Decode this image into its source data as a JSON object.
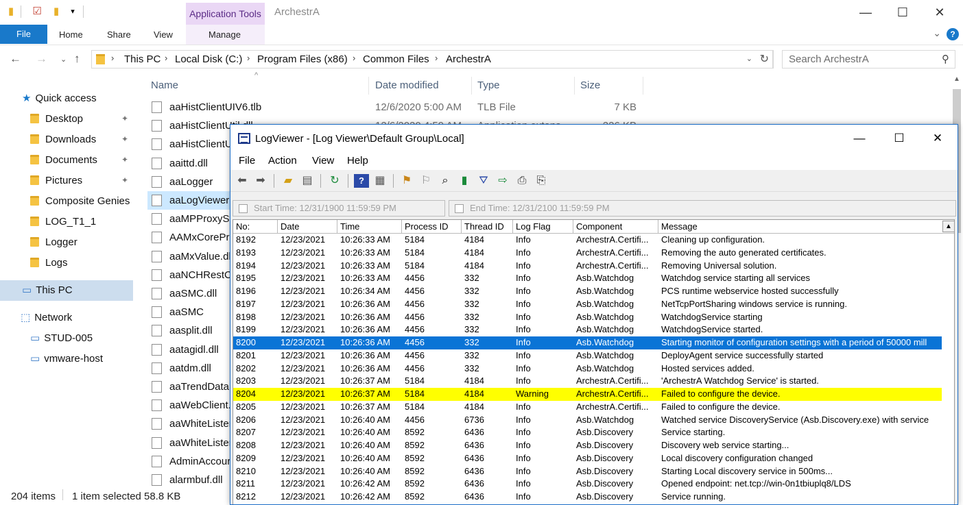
{
  "explorer": {
    "title": "ArchestrA",
    "app_tools_tab": "Application Tools",
    "ribbon": {
      "file": "File",
      "home": "Home",
      "share": "Share",
      "view": "View",
      "manage": "Manage",
      "help": "?"
    },
    "breadcrumb": [
      "This PC",
      "Local Disk (C:)",
      "Program Files (x86)",
      "Common Files",
      "ArchestrA"
    ],
    "search_placeholder": "Search ArchestrA",
    "columns": {
      "name": "Name",
      "date": "Date modified",
      "type": "Type",
      "size": "Size"
    },
    "sidebar": {
      "quick_access": "Quick access",
      "items": [
        {
          "label": "Desktop",
          "pinned": true
        },
        {
          "label": "Downloads",
          "pinned": true
        },
        {
          "label": "Documents",
          "pinned": true
        },
        {
          "label": "Pictures",
          "pinned": true
        },
        {
          "label": "Composite Genies",
          "pinned": false
        },
        {
          "label": "LOG_T1_1",
          "pinned": false
        },
        {
          "label": "Logger",
          "pinned": false
        },
        {
          "label": "Logs",
          "pinned": false
        }
      ],
      "this_pc": "This PC",
      "network": "Network",
      "network_items": [
        "STUD-005",
        "vmware-host"
      ]
    },
    "files": [
      {
        "name": "aaHistClientUIV6.tlb",
        "date": "12/6/2020 5:00 AM",
        "type": "TLB File",
        "size": "7 KB"
      },
      {
        "name": "aaHistClientUtil.dll",
        "date": "12/6/2020 4:59 AM",
        "type": "Application extens",
        "size": "226 KB"
      },
      {
        "name": "aaHistClientU",
        "date": "",
        "type": "",
        "size": ""
      },
      {
        "name": "aaittd.dll",
        "date": "",
        "type": "",
        "size": ""
      },
      {
        "name": "aaLogger",
        "date": "",
        "type": "",
        "size": ""
      },
      {
        "name": "aaLogViewer",
        "date": "",
        "type": "",
        "size": ""
      },
      {
        "name": "aaMPProxySt",
        "date": "",
        "type": "",
        "size": ""
      },
      {
        "name": "AAMxCorePro",
        "date": "",
        "type": "",
        "size": ""
      },
      {
        "name": "aaMxValue.dll",
        "date": "",
        "type": "",
        "size": ""
      },
      {
        "name": "aaNCHRestCl",
        "date": "",
        "type": "",
        "size": ""
      },
      {
        "name": "aaSMC.dll",
        "date": "",
        "type": "",
        "size": ""
      },
      {
        "name": "aaSMC",
        "date": "",
        "type": "",
        "size": ""
      },
      {
        "name": "aasplit.dll",
        "date": "",
        "type": "",
        "size": ""
      },
      {
        "name": "aatagidl.dll",
        "date": "",
        "type": "",
        "size": ""
      },
      {
        "name": "aatdm.dll",
        "date": "",
        "type": "",
        "size": ""
      },
      {
        "name": "aaTrendDataS",
        "date": "",
        "type": "",
        "size": ""
      },
      {
        "name": "aaWebClient.",
        "date": "",
        "type": "",
        "size": ""
      },
      {
        "name": "aaWhiteLister",
        "date": "",
        "type": "",
        "size": ""
      },
      {
        "name": "aaWhiteLister",
        "date": "",
        "type": "",
        "size": ""
      },
      {
        "name": "AdminAccour",
        "date": "",
        "type": "",
        "size": ""
      },
      {
        "name": "alarmbuf.dll",
        "date": "",
        "type": "",
        "size": ""
      }
    ],
    "selected_file": "aaLogViewer",
    "status": {
      "items": "204 items",
      "selected": "1 item selected",
      "size": "58.8 KB"
    }
  },
  "logviewer": {
    "title": "LogViewer - [Log Viewer\\Default Group\\Local]",
    "menu": [
      "File",
      "Action",
      "View",
      "Help"
    ],
    "start_time": "Start Time: 12/31/1900    11:59:59 PM",
    "end_time": "End Time: 12/31/2100    11:59:59 PM",
    "columns": [
      "No:",
      "Date",
      "Time",
      "Process ID",
      "Thread ID",
      "Log Flag",
      "Component",
      "Message"
    ],
    "rows": [
      [
        "8192",
        "12/23/2021",
        "10:26:33 AM",
        "5184",
        "4184",
        "Info",
        "ArchestrA.Certifi...",
        "Cleaning up configuration."
      ],
      [
        "8193",
        "12/23/2021",
        "10:26:33 AM",
        "5184",
        "4184",
        "Info",
        "ArchestrA.Certifi...",
        "Removing the auto generated certificates."
      ],
      [
        "8194",
        "12/23/2021",
        "10:26:33 AM",
        "5184",
        "4184",
        "Info",
        "ArchestrA.Certifi...",
        "Removing Universal solution."
      ],
      [
        "8195",
        "12/23/2021",
        "10:26:33 AM",
        "4456",
        "332",
        "Info",
        "Asb.Watchdog",
        "Watchdog service starting all services"
      ],
      [
        "8196",
        "12/23/2021",
        "10:26:34 AM",
        "4456",
        "332",
        "Info",
        "Asb.Watchdog",
        "PCS runtime webservice hosted successfully"
      ],
      [
        "8197",
        "12/23/2021",
        "10:26:36 AM",
        "4456",
        "332",
        "Info",
        "Asb.Watchdog",
        "NetTcpPortSharing windows service is running."
      ],
      [
        "8198",
        "12/23/2021",
        "10:26:36 AM",
        "4456",
        "332",
        "Info",
        "Asb.Watchdog",
        "WatchdogService starting"
      ],
      [
        "8199",
        "12/23/2021",
        "10:26:36 AM",
        "4456",
        "332",
        "Info",
        "Asb.Watchdog",
        "WatchdogService started."
      ],
      [
        "8200",
        "12/23/2021",
        "10:26:36 AM",
        "4456",
        "332",
        "Info",
        "Asb.Watchdog",
        "Starting monitor of configuration settings with a period of 50000 mill"
      ],
      [
        "8201",
        "12/23/2021",
        "10:26:36 AM",
        "4456",
        "332",
        "Info",
        "Asb.Watchdog",
        "DeployAgent service successfully started"
      ],
      [
        "8202",
        "12/23/2021",
        "10:26:36 AM",
        "4456",
        "332",
        "Info",
        "Asb.Watchdog",
        "Hosted services added."
      ],
      [
        "8203",
        "12/23/2021",
        "10:26:37 AM",
        "5184",
        "4184",
        "Info",
        "ArchestrA.Certifi...",
        "'ArchestrA Watchdog Service' is started."
      ],
      [
        "8204",
        "12/23/2021",
        "10:26:37 AM",
        "5184",
        "4184",
        "Warning",
        "ArchestrA.Certifi...",
        "Failed to configure the device."
      ],
      [
        "8205",
        "12/23/2021",
        "10:26:37 AM",
        "5184",
        "4184",
        "Info",
        "ArchestrA.Certifi...",
        "Failed to configure the device."
      ],
      [
        "8206",
        "12/23/2021",
        "10:26:40 AM",
        "4456",
        "6736",
        "Info",
        "Asb.Watchdog",
        "Watched service DiscoveryService (Asb.Discovery.exe) with service"
      ],
      [
        "8207",
        "12/23/2021",
        "10:26:40 AM",
        "8592",
        "6436",
        "Info",
        "Asb.Discovery",
        "Service starting."
      ],
      [
        "8208",
        "12/23/2021",
        "10:26:40 AM",
        "8592",
        "6436",
        "Info",
        "Asb.Discovery",
        "Discovery web service starting..."
      ],
      [
        "8209",
        "12/23/2021",
        "10:26:40 AM",
        "8592",
        "6436",
        "Info",
        "Asb.Discovery",
        "Local discovery configuration changed"
      ],
      [
        "8210",
        "12/23/2021",
        "10:26:40 AM",
        "8592",
        "6436",
        "Info",
        "Asb.Discovery",
        "Starting Local discovery service in 500ms..."
      ],
      [
        "8211",
        "12/23/2021",
        "10:26:42 AM",
        "8592",
        "6436",
        "Info",
        "Asb.Discovery",
        "Opened endpoint: net.tcp://win-0n1tbiuplq8/LDS"
      ],
      [
        "8212",
        "12/23/2021",
        "10:26:42 AM",
        "8592",
        "6436",
        "Info",
        "Asb.Discovery",
        "Service running."
      ]
    ],
    "selected_no": "8200",
    "warning_no": "8204"
  },
  "colors": {
    "accent": "#1979ca",
    "selected_row": "#0a74d6",
    "warning_row": "#ffff00",
    "tools_tab": "#ead7f5"
  }
}
